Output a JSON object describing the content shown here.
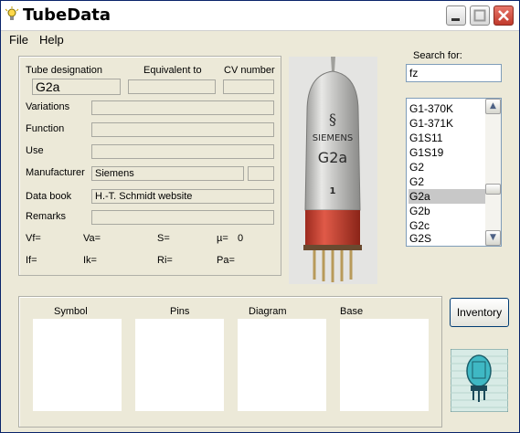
{
  "app": {
    "title": "TubeData"
  },
  "menu": [
    "File",
    "Help"
  ],
  "fields": {
    "tube_designation_label": "Tube designation",
    "tube_designation": "G2a",
    "equivalent_label": "Equivalent to",
    "equivalent": "",
    "cv_number_label": "CV number",
    "cv_number": "",
    "variations_label": "Variations",
    "variations": "",
    "function_label": "Function",
    "function": "",
    "use_label": "Use",
    "use": "",
    "manufacturer_label": "Manufacturer",
    "manufacturer": "Siemens",
    "manufacturer_code": "",
    "data_book_label": "Data book",
    "data_book": "H.-T. Schmidt website",
    "remarks_label": "Remarks",
    "remarks": ""
  },
  "params": {
    "vf": "Vf=",
    "va": "Va=",
    "s": "S=",
    "mu": "µ=",
    "mu_value": "0",
    "if": "If=",
    "ik": "Ik=",
    "ri": "Ri=",
    "pa": "Pa="
  },
  "tube_photo": {
    "brand": "SIEMENS",
    "model": "G2a",
    "number": "1"
  },
  "search": {
    "label": "Search for:",
    "value": "fz"
  },
  "tube_list": {
    "items": [
      "G1-370K",
      "G1-371K",
      "G1S11",
      "G1S19",
      "G2",
      "G2",
      "G2a",
      "G2b",
      "G2c",
      "G2S"
    ],
    "selected": "G2a"
  },
  "panels": [
    "Symbol",
    "Pins",
    "Diagram",
    "Base"
  ],
  "buttons": {
    "inventory": "Inventory"
  },
  "colors": {
    "selection": "#c8c8c8",
    "window_bg": "#ece9d8",
    "tube_red": "#c23a2a"
  }
}
